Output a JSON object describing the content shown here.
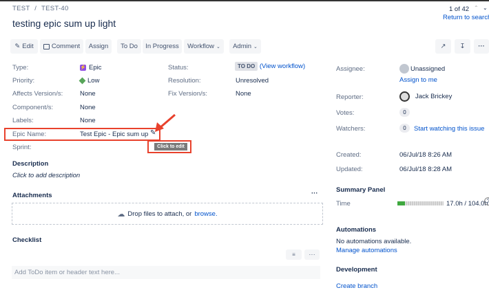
{
  "breadcrumb": {
    "project": "TEST",
    "separator": "/",
    "issue_key": "TEST-40"
  },
  "title": "testing epic sum up light",
  "pager": {
    "position": "1 of 42",
    "return_label": "Return to search"
  },
  "toolbar": {
    "edit": "Edit",
    "comment": "Comment",
    "assign": "Assign",
    "todo": "To Do",
    "in_progress": "In Progress",
    "workflow": "Workflow",
    "admin": "Admin"
  },
  "fields": {
    "type": {
      "label": "Type:",
      "value": "Epic"
    },
    "priority": {
      "label": "Priority:",
      "value": "Low"
    },
    "affects": {
      "label": "Affects Version/s:",
      "value": "None"
    },
    "components": {
      "label": "Component/s:",
      "value": "None"
    },
    "labels": {
      "label": "Labels:",
      "value": "None"
    },
    "epic_name": {
      "label": "Epic Name:",
      "value": "Test Epic - Epic sum up"
    },
    "sprint": {
      "label": "Sprint:",
      "tooltip": "Click to edit"
    },
    "status": {
      "label": "Status:",
      "value": "TO DO",
      "link": "(View workflow)"
    },
    "resolution": {
      "label": "Resolution:",
      "value": "Unresolved"
    },
    "fix": {
      "label": "Fix Version/s:",
      "value": "None"
    }
  },
  "description": {
    "heading": "Description",
    "placeholder": "Click to add description"
  },
  "attachments": {
    "heading": "Attachments",
    "drop_text": "Drop files to attach, or",
    "browse": "browse."
  },
  "checklist": {
    "heading": "Checklist",
    "placeholder": "Add ToDo item or header text here..."
  },
  "people": {
    "assignee_label": "Assignee:",
    "assignee": "Unassigned",
    "assign_to_me": "Assign to me",
    "reporter_label": "Reporter:",
    "reporter": "Jack Brickey",
    "votes_label": "Votes:",
    "votes": "0",
    "watchers_label": "Watchers:",
    "watchers": "0",
    "watch_link": "Start watching this issue"
  },
  "dates": {
    "created_label": "Created:",
    "created": "06/Jul/18 8:26 AM",
    "updated_label": "Updated:",
    "updated": "06/Jul/18 8:28 AM"
  },
  "summary": {
    "heading": "Summary Panel",
    "time_label": "Time",
    "time_value": "17.0h / 104.0h",
    "progress": 0.163
  },
  "automations": {
    "heading": "Automations",
    "text": "No automations available.",
    "link": "Manage automations"
  },
  "development": {
    "heading": "Development",
    "link": "Create branch"
  },
  "colors": {
    "accent": "#0052cc",
    "annotation": "#e8412c",
    "progress": "#3fa83f"
  }
}
